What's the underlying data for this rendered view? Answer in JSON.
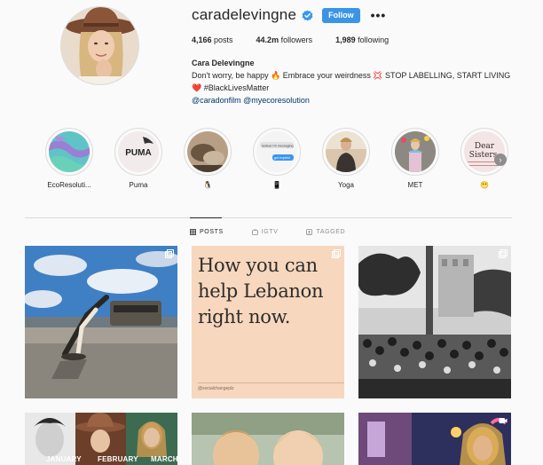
{
  "profile": {
    "username": "caradelevingne",
    "follow_label": "Follow",
    "more_label": "•••",
    "stats": [
      {
        "value": "4,166",
        "label": " posts"
      },
      {
        "value": "44.2m",
        "label": " followers"
      },
      {
        "value": "1,989",
        "label": " following"
      }
    ],
    "full_name": "Cara Delevingne",
    "bio_line1": "Don't worry, be happy 🔥 Embrace your weirdness 💢 STOP LABELLING, START LIVING",
    "bio_line2": "❤️ #BlackLivesMatter",
    "bio_tags": "@caradonfilm @myecoresolution"
  },
  "highlights": [
    {
      "label": "EcoResoluti..."
    },
    {
      "label": "Puma",
      "text": "PUMA"
    },
    {
      "label": "🐧"
    },
    {
      "label": "📱",
      "text1": "believe I'm messaging",
      "text2": "got expired"
    },
    {
      "label": "Yoga"
    },
    {
      "label": "MET"
    },
    {
      "label": "😬",
      "text1": "Dear",
      "text2": "Sisters,"
    }
  ],
  "tabs": [
    {
      "label": "POSTS"
    },
    {
      "label": "IGTV"
    },
    {
      "label": "TAGGED"
    }
  ],
  "posts": {
    "lebanon_line1": "How you can",
    "lebanon_line2": "help Lebanon",
    "lebanon_line3": "right now.",
    "lebanon_handle": "@socialchangeplz",
    "months": [
      "JANUARY",
      "FEBRUARY",
      "MARCH"
    ]
  },
  "colors": {
    "follow_bg": "#3b95e6",
    "verified": "#3897f0",
    "link": "#00376b",
    "lebanon_bg": "#f7d7bd"
  }
}
